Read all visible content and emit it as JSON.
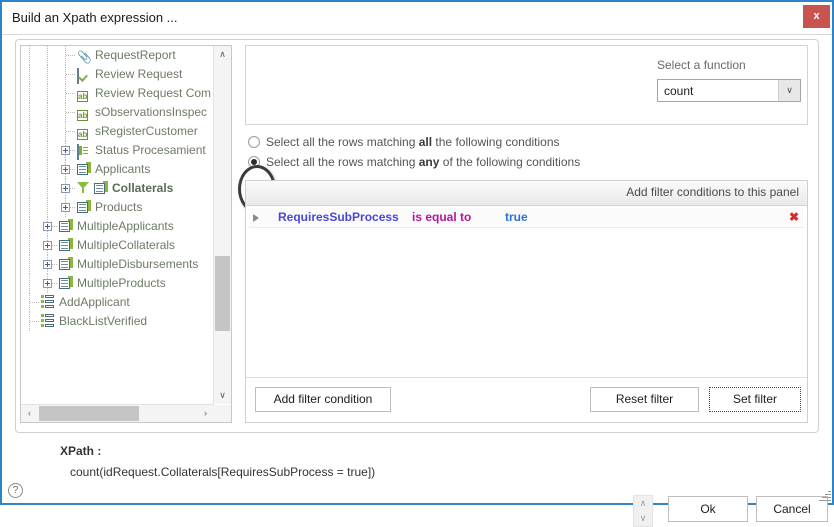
{
  "window": {
    "title": "Build an Xpath expression ...",
    "close_label": "x",
    "accent_color": "#2e84c8",
    "close_color": "#c9544f"
  },
  "tree": {
    "items": [
      {
        "label": "RequestReport",
        "icon": "paperclip-icon",
        "indent": 3,
        "expander": false,
        "bold": false
      },
      {
        "label": "Review Request",
        "icon": "checkbox-icon",
        "indent": 3,
        "expander": false,
        "bold": false
      },
      {
        "label": "Review Request Com",
        "icon": "ab-text-icon",
        "indent": 3,
        "expander": false,
        "bold": false
      },
      {
        "label": "sObservationsInspec",
        "icon": "ab-text-icon",
        "indent": 3,
        "expander": false,
        "bold": false
      },
      {
        "label": "sRegisterCustomer",
        "icon": "ab-text-icon",
        "indent": 3,
        "expander": false,
        "bold": false
      },
      {
        "label": "Status Procesamient",
        "icon": "status-icon",
        "indent": 3,
        "expander": true,
        "bold": false
      },
      {
        "label": "Applicants",
        "icon": "grid-icon",
        "indent": 3,
        "expander": true,
        "bold": false
      },
      {
        "label": "Collaterals",
        "icon": "funnel-grid-icon",
        "indent": 3,
        "expander": true,
        "bold": true
      },
      {
        "label": "Products",
        "icon": "grid-icon",
        "indent": 3,
        "expander": true,
        "bold": false
      },
      {
        "label": "MultipleApplicants",
        "icon": "grid-icon",
        "indent": 2,
        "expander": true,
        "bold": false
      },
      {
        "label": "MultipleCollaterals",
        "icon": "grid-icon",
        "indent": 2,
        "expander": true,
        "bold": false
      },
      {
        "label": "MultipleDisbursements",
        "icon": "grid-icon",
        "indent": 2,
        "expander": true,
        "bold": false
      },
      {
        "label": "MultipleProducts",
        "icon": "grid-icon",
        "indent": 2,
        "expander": true,
        "bold": false
      },
      {
        "label": "AddApplicant",
        "icon": "list-icon",
        "indent": 1,
        "expander": false,
        "bold": false
      },
      {
        "label": "BlackListVerified",
        "icon": "list-icon",
        "indent": 1,
        "expander": false,
        "bold": false
      }
    ],
    "scroll_up": "∧",
    "scroll_down": "∨",
    "scroll_left": "‹",
    "scroll_right": "›"
  },
  "function_panel": {
    "label": "Select a function",
    "selected": "count",
    "dropdown_arrow": "∨"
  },
  "match_options": [
    {
      "prefix": "Select all the rows matching ",
      "strong": "all",
      "suffix": " the following conditions",
      "selected": false
    },
    {
      "prefix": "Select all the rows matching ",
      "strong": "any",
      "suffix": " of the following conditions",
      "selected": true
    }
  ],
  "filter_panel": {
    "header": "Add filter conditions to this panel",
    "conditions": [
      {
        "field": "RequiresSubProcess",
        "operator": "is equal to",
        "value": "true",
        "delete_label": "✖"
      }
    ],
    "buttons": {
      "add_condition": "Add filter condition",
      "reset_filter": "Reset  filter",
      "set_filter": "Set  filter"
    }
  },
  "xpath": {
    "label": "XPath :",
    "value": "count(idRequest.Collaterals[RequiresSubProcess = true])"
  },
  "footer": {
    "help_label": "?",
    "spinner_up": "∧",
    "spinner_down": "∨",
    "ok_label": "Ok",
    "cancel_label": "Cancel"
  }
}
